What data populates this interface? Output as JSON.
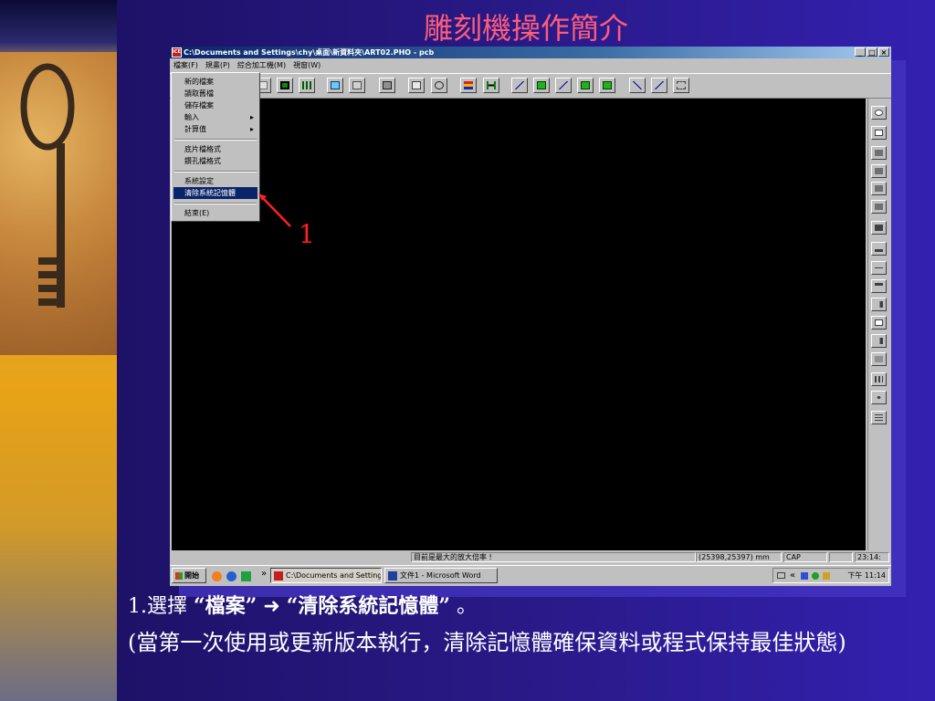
{
  "slide": {
    "title": "雕刻機操作簡介",
    "caption_prefix": "1.選擇",
    "caption_q1": "“檔案”",
    "caption_arrow": "➜",
    "caption_q2": "“清除系統記憶體”",
    "caption_end": "。",
    "note": "(當第一次使用或更新版本執行，清除記憶體確保資料或程式保持最佳狀態)",
    "callout_number": "1"
  },
  "window": {
    "title": "C:\\Documents and Settings\\chy\\桌面\\新資料夾\\ART02.PHO - pcb",
    "app_icon_text": "ICE",
    "buttons": {
      "minimize": "_",
      "maximize": "□",
      "close": "×"
    }
  },
  "menubar": {
    "items": [
      "檔案(F)",
      "規畫(P)",
      "綜合加工機(M)",
      "視窗(W)"
    ]
  },
  "file_menu": {
    "items": [
      {
        "label": "新的檔案"
      },
      {
        "label": "讀取舊檔"
      },
      {
        "label": "儲存檔案"
      },
      {
        "label": "輸入",
        "submenu": "▸"
      },
      {
        "label": "計算值",
        "submenu": "▸"
      },
      {
        "label": "底片檔格式"
      },
      {
        "label": "鑽孔檔格式"
      },
      {
        "label": "系統設定"
      },
      {
        "label": "清除系統記憶體",
        "selected": true
      },
      {
        "label": "結束(E)"
      }
    ]
  },
  "toolbar": {
    "buttons": [
      "new-icon",
      "open-icon",
      "save-icon",
      "grid-icon",
      "layer-icon",
      "select-icon",
      "window-icon",
      "box-icon",
      "calc-icon",
      "zoom-window-icon",
      "zoom-in-icon",
      "layers-icon",
      "width-icon",
      "trace1-icon",
      "trace2-icon",
      "trace3-icon",
      "trace4-icon",
      "cut-icon",
      "merge-icon",
      "split-icon"
    ]
  },
  "statusbar": {
    "message": "目前是最大的放大倍率 !",
    "coords": "(25398,25397) mm",
    "caps": "CAP",
    "time": "23:14:"
  },
  "taskbar": {
    "start": "開始",
    "chevron": "»",
    "task1": "C:\\Documents and Setting...",
    "task2": "文件1 - Microsoft Word",
    "tray_chevron": "«",
    "clock": "下午 11:14"
  },
  "colors": {
    "title": "#ff5c7a",
    "menu_highlight": "#0a246a",
    "callout": "#ff2020"
  }
}
